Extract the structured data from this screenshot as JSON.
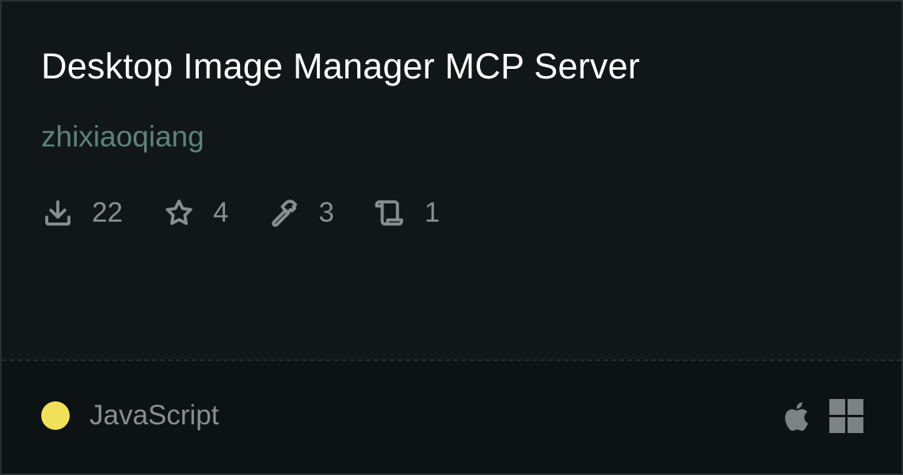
{
  "server": {
    "title": "Desktop Image Manager MCP Server",
    "author": "zhixiaoqiang"
  },
  "stats": [
    {
      "icon": "download-icon",
      "value": "22"
    },
    {
      "icon": "star-icon",
      "value": "4"
    },
    {
      "icon": "hammer-icon",
      "value": "3"
    },
    {
      "icon": "scroll-icon",
      "value": "1"
    }
  ],
  "language": {
    "name": "JavaScript",
    "color": "#f1e05a"
  },
  "platforms": [
    {
      "icon": "apple-icon"
    },
    {
      "icon": "windows-icon"
    }
  ],
  "colors": {
    "author": "#5e8379",
    "muted": "#8a8e90",
    "background": "#111719"
  }
}
